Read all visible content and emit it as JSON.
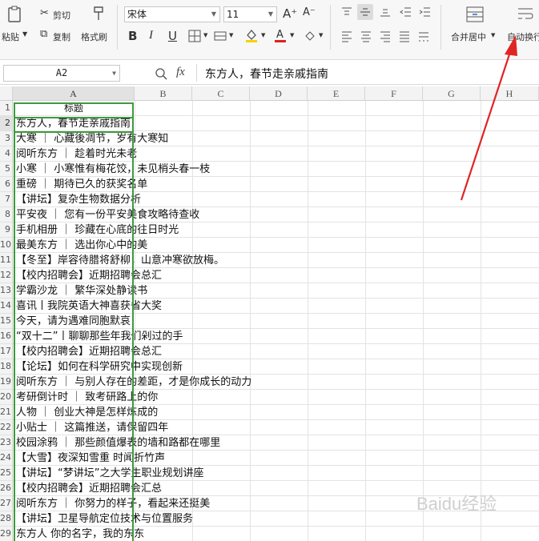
{
  "ribbon": {
    "paste_label": "粘贴",
    "cut_label": "剪切",
    "copy_label": "复制",
    "format_painter_label": "格式刷",
    "font_name": "宋体",
    "font_size": "11",
    "bold": "B",
    "italic": "I",
    "underline": "U",
    "font_grow": "A⁺",
    "font_shrink": "A⁻",
    "merge_center_label": "合并居中",
    "auto_wrap_label": "自动换行"
  },
  "formula_bar": {
    "name_box": "A2",
    "fx": "fx",
    "content": "东方人，春节走亲戚指南"
  },
  "columns": [
    "A",
    "B",
    "C",
    "D",
    "E",
    "F",
    "G",
    "H"
  ],
  "rows": [
    {
      "num": "1",
      "text": "标题"
    },
    {
      "num": "2",
      "text": "东方人，春节走亲戚指南"
    },
    {
      "num": "3",
      "text": "大寒 ｜ 心藏後凋节，岁有大寒知"
    },
    {
      "num": "4",
      "text": "阅听东方 ｜ 趁着时光未老"
    },
    {
      "num": "5",
      "text": "小寒 ｜ 小寒惟有梅花饺，未见梢头春一枝"
    },
    {
      "num": "6",
      "text": "重磅 ｜ 期待已久的获奖名单"
    },
    {
      "num": "7",
      "text": "【讲坛】复杂生物数据分析"
    },
    {
      "num": "8",
      "text": "平安夜 ｜ 您有一份平安美食攻略待查收"
    },
    {
      "num": "9",
      "text": "手机相册 ｜ 珍藏在心底的往日时光"
    },
    {
      "num": "10",
      "text": "最美东方 ｜ 选出你心中的美"
    },
    {
      "num": "11",
      "text": "【冬至】岸容待腊将舒柳，山意冲寒欲放梅。"
    },
    {
      "num": "12",
      "text": "【校内招聘会】近期招聘会总汇"
    },
    {
      "num": "13",
      "text": "学霸沙龙 ｜ 繁华深处静读书"
    },
    {
      "num": "14",
      "text": "喜讯丨我院英语大神喜获省大奖"
    },
    {
      "num": "15",
      "text": "今天，请为遇难同胞默哀"
    },
    {
      "num": "16",
      "text": "“双十二”丨聊聊那些年我们剁过的手"
    },
    {
      "num": "17",
      "text": "【校内招聘会】近期招聘会总汇"
    },
    {
      "num": "18",
      "text": "【论坛】如何在科学研究中实现创新"
    },
    {
      "num": "19",
      "text": "阅听东方 ｜ 与别人存在的差距，才是你成长的动力"
    },
    {
      "num": "20",
      "text": "考研倒计时 ｜ 致考研路上的你"
    },
    {
      "num": "21",
      "text": "人物 ｜ 创业大神是怎样炼成的"
    },
    {
      "num": "22",
      "text": "小贴士 ｜ 这篇推送，请保留四年"
    },
    {
      "num": "23",
      "text": "校园涂鸦 ｜ 那些颜值爆表的墙和路都在哪里"
    },
    {
      "num": "24",
      "text": "【大雪】夜深知雪重 时闻折竹声"
    },
    {
      "num": "25",
      "text": "【讲坛】“梦讲坛”之大学生职业规划讲座"
    },
    {
      "num": "26",
      "text": "【校内招聘会】近期招聘会汇总"
    },
    {
      "num": "27",
      "text": "阅听东方 ｜ 你努力的样子，看起来还挺美"
    },
    {
      "num": "28",
      "text": "【讲坛】卫星导航定位技术与位置服务"
    },
    {
      "num": "29",
      "text": "东方人 你的名字，我的东东"
    }
  ],
  "watermark": "Baidu经验",
  "colors": {
    "selection": "#3c9b3c",
    "arrow": "#e02525",
    "header_bg": "#f3f3f3"
  }
}
